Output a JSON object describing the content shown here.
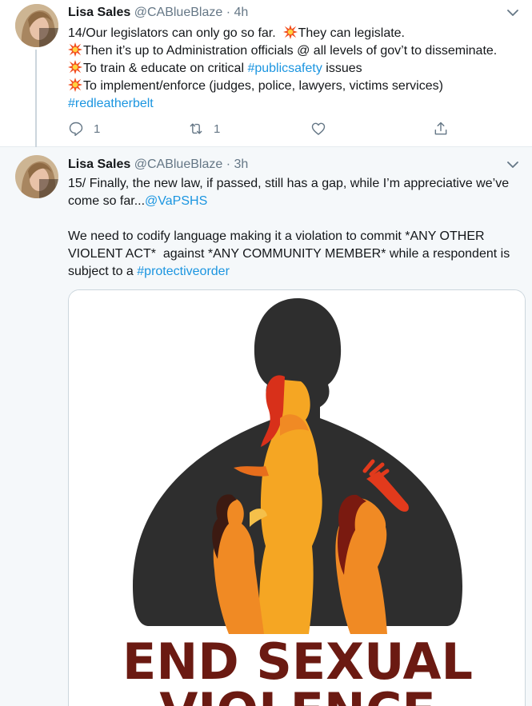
{
  "tweets": [
    {
      "name": "Lisa Sales",
      "handle": "@CABlueBlaze",
      "separator": "·",
      "time": "4h",
      "lines": [
        [
          {
            "t": "14/Our legislators can only go so far.  "
          },
          {
            "e": "collision-emoji"
          },
          {
            "t": "They can legislate."
          }
        ],
        [
          {
            "e": "collision-emoji"
          },
          {
            "t": "Then it’s up to Administration officials @ all levels of gov’t to disseminate."
          }
        ],
        [
          {
            "e": "collision-emoji"
          },
          {
            "t": "To train & educate on critical "
          },
          {
            "l": "#publicsafety"
          },
          {
            "t": " issues"
          }
        ],
        [
          {
            "e": "collision-emoji"
          },
          {
            "t": "To implement/enforce (judges, police, lawyers, victims services)"
          }
        ],
        [
          {
            "l": "#redleatherbelt"
          }
        ]
      ],
      "replies": "1",
      "retweets": "1"
    },
    {
      "name": "Lisa Sales",
      "handle": "@CABlueBlaze",
      "separator": "·",
      "time": "3h",
      "lines": [
        [
          {
            "t": "15/ Finally, the new law, if passed, still has a gap, while I’m appreciative we’ve"
          }
        ],
        [
          {
            "t": "come so far..."
          },
          {
            "l": "@VaPSHS"
          }
        ],
        [],
        [
          {
            "t": "We need to codify language making it a violation to commit *ANY OTHER"
          }
        ],
        [
          {
            "t": "VIOLENT ACT*  against *ANY COMMUNITY MEMBER* while a respondent is"
          }
        ],
        [
          {
            "t": "subject to a "
          },
          {
            "l": "#protectiveorder"
          }
        ]
      ],
      "image_text_line1": "END SEXUAL",
      "image_text_line2": "VIOLENCE"
    }
  ],
  "colors": {
    "link": "#1b95e0",
    "secondary_text": "#657786",
    "highlighted_background": "#f5f8fa",
    "poster_dark": "#2e2e2e",
    "poster_text": "#6b1a12"
  },
  "icons": [
    "chevron-down-icon",
    "reply-icon",
    "retweet-icon",
    "like-icon",
    "share-icon",
    "collision-emoji"
  ]
}
